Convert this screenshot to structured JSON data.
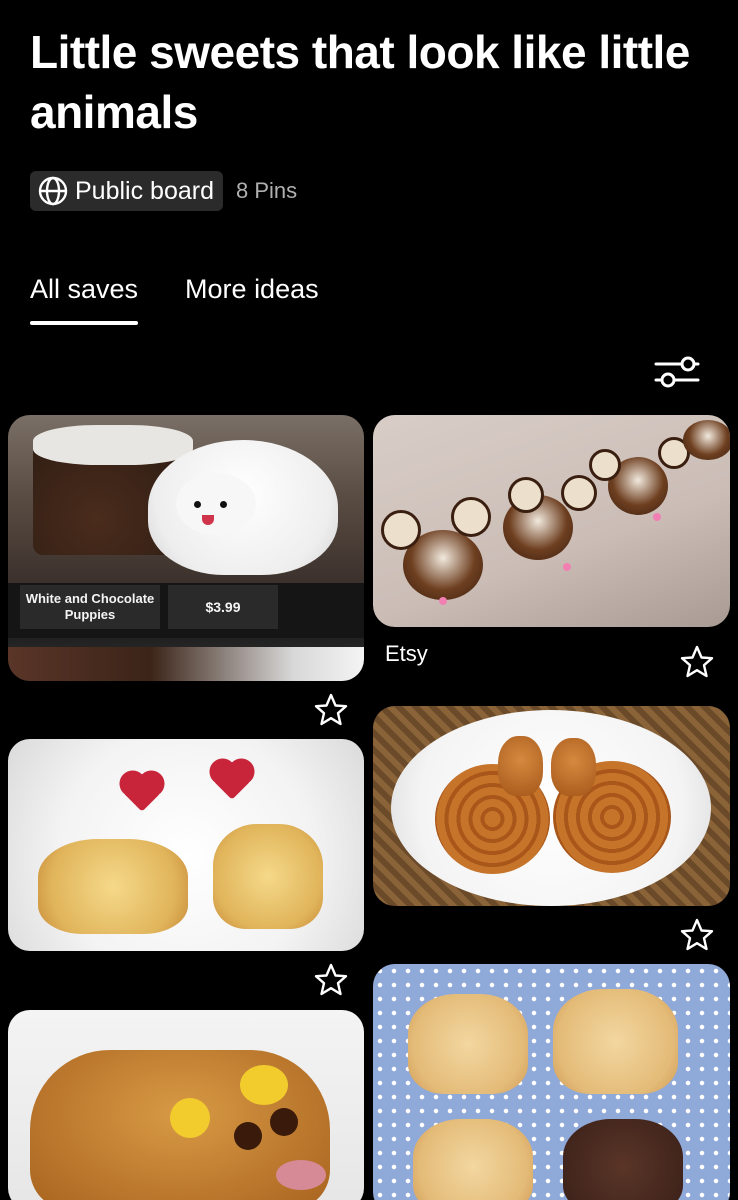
{
  "board": {
    "title": "Little sweets that look like little animals",
    "visibility_icon": "globe-icon",
    "visibility_label": "Public board",
    "pin_count": "8 Pins"
  },
  "tabs": [
    {
      "label": "All saves",
      "active": true
    },
    {
      "label": "More ideas",
      "active": false
    }
  ],
  "filter_icon": "sliders-icon",
  "pins": [
    {
      "id": "cake-dog",
      "photo_text": {
        "tag": "White and Chocolate\nPuppies",
        "price": "$3.99"
      },
      "label": "",
      "save_icon": "star-icon"
    },
    {
      "id": "chocolate-mice",
      "label": "Etsy",
      "save_icon": "star-icon"
    },
    {
      "id": "cat-toast",
      "label": "",
      "save_icon": "star-icon"
    },
    {
      "id": "snail-buns",
      "label": "",
      "save_icon": "star-icon"
    },
    {
      "id": "twinkie-hamster",
      "label": "",
      "save_icon": "star-icon"
    },
    {
      "id": "cat-cookies",
      "label": "",
      "save_icon": "star-icon"
    }
  ],
  "colors": {
    "background": "#000000",
    "pill": "#2b2b2b",
    "text": "#ffffff",
    "muted": "#b0b0b0"
  }
}
